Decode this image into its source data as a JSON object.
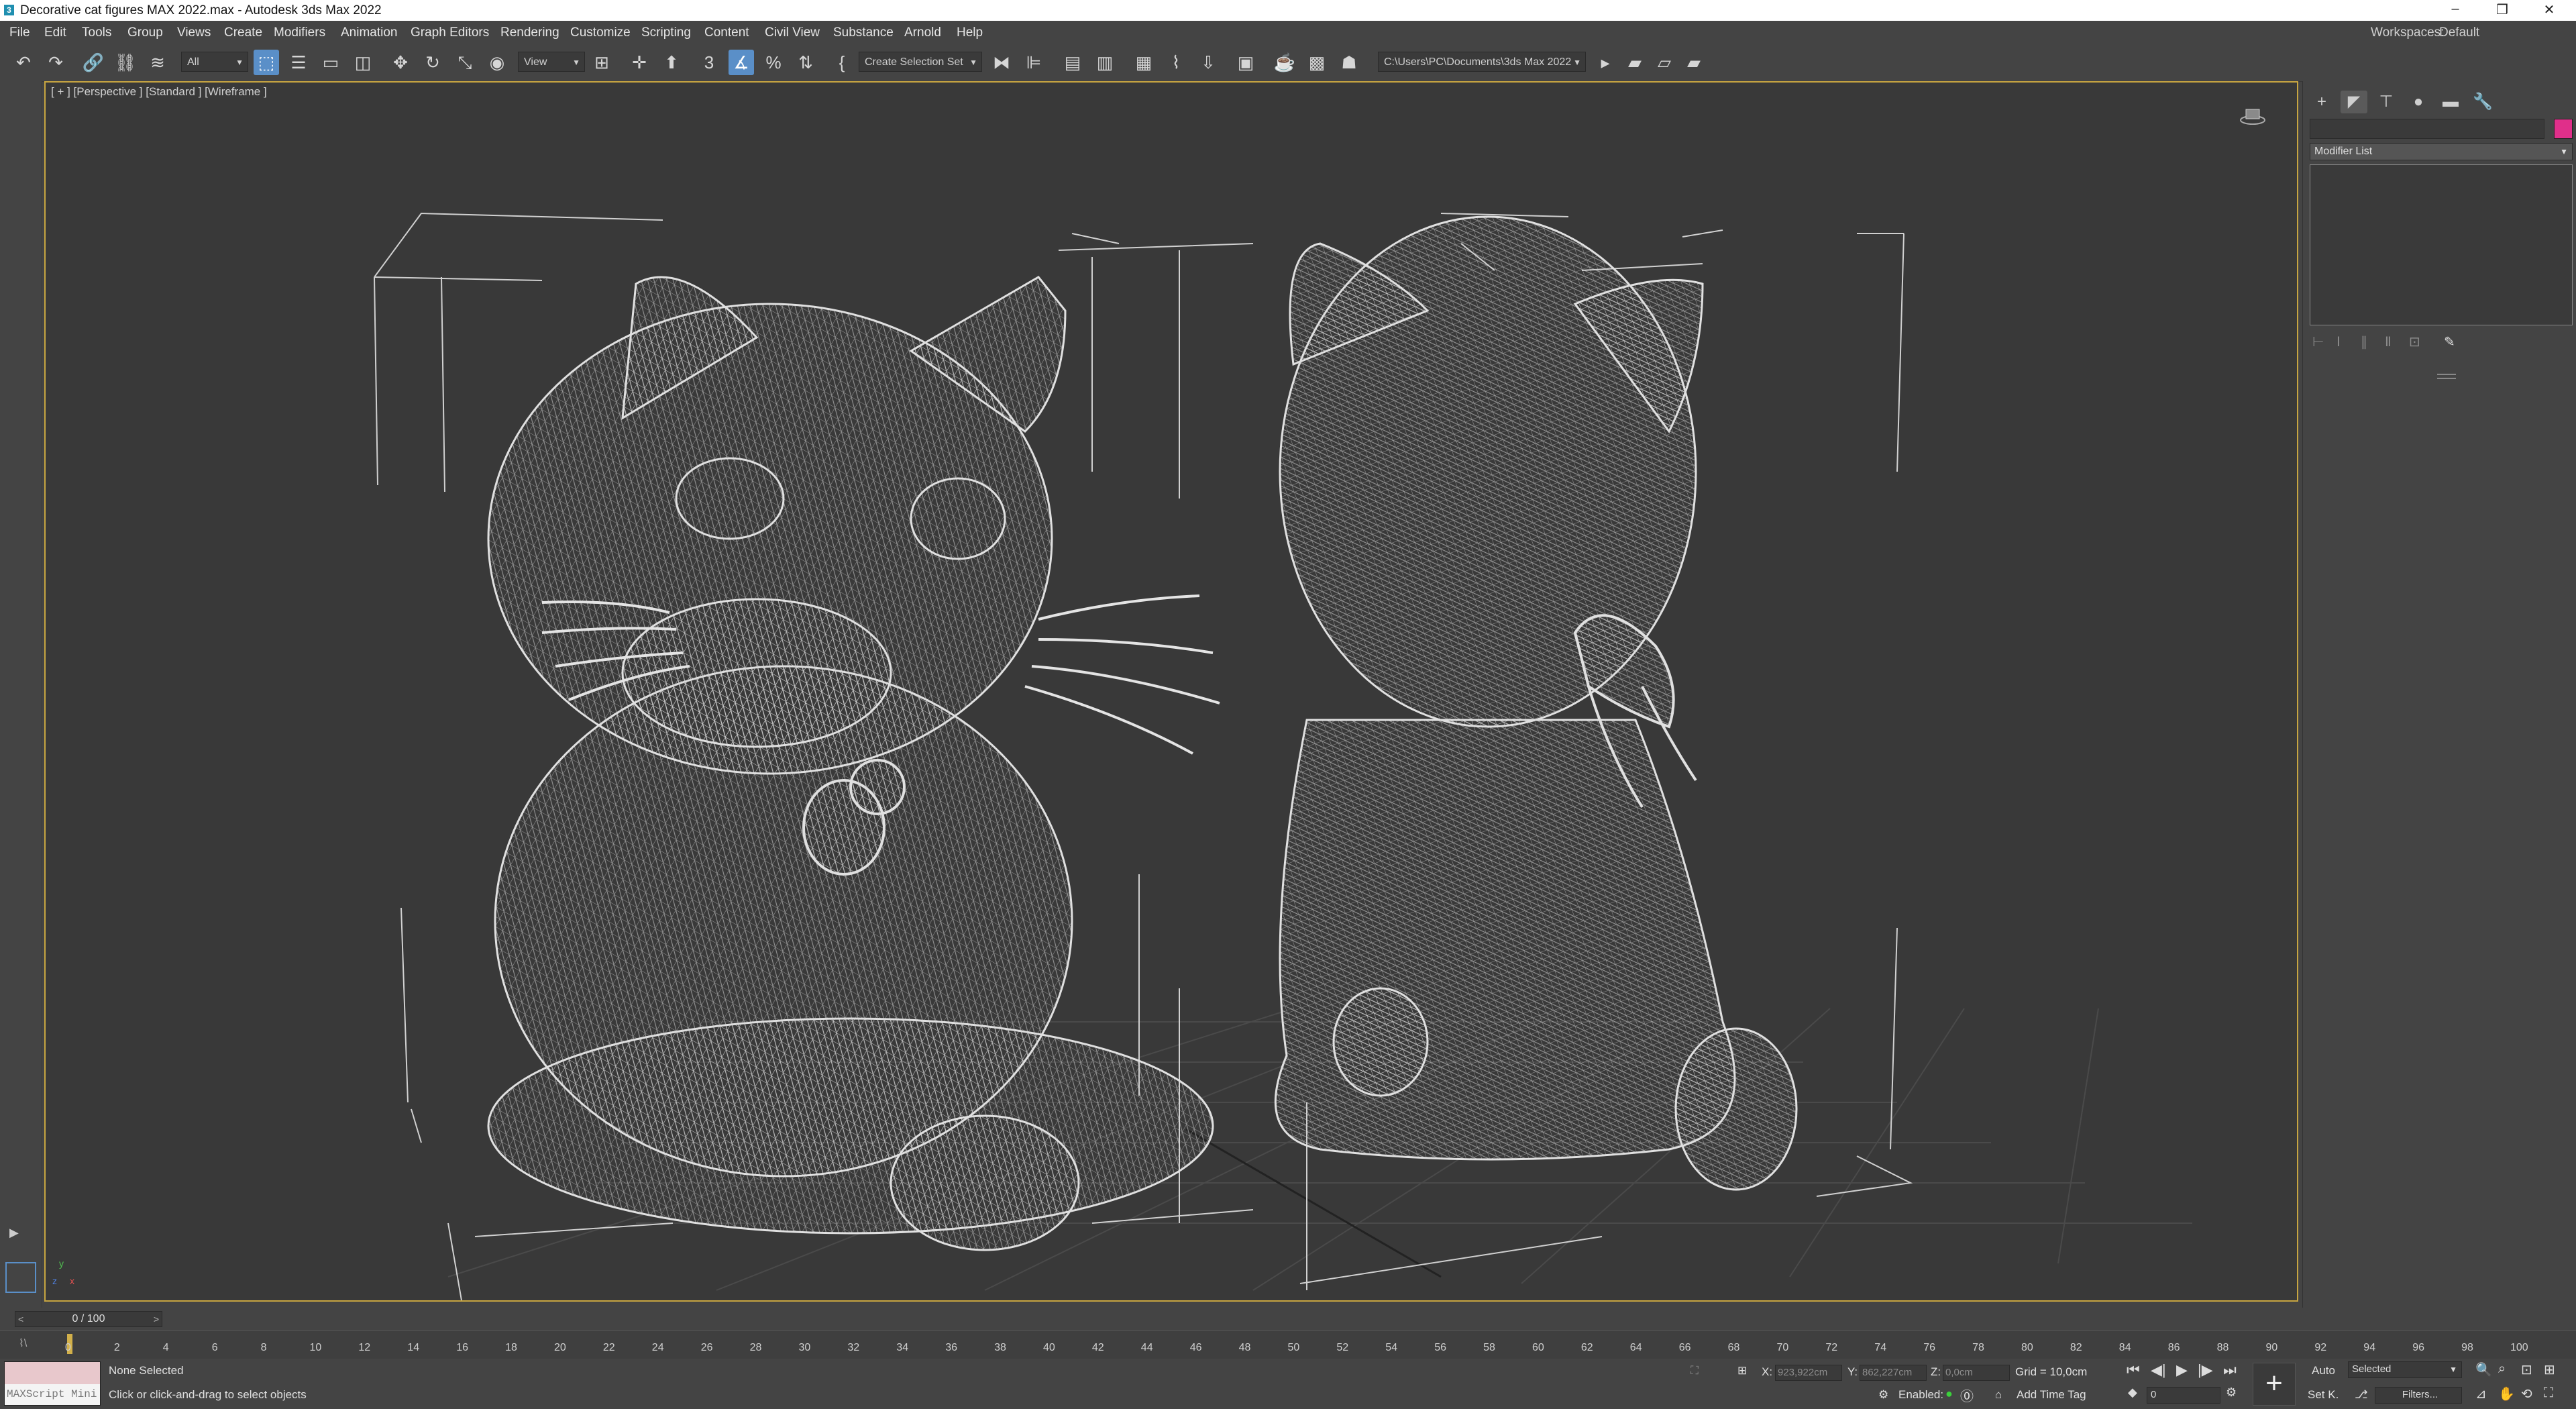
{
  "window": {
    "title": "Decorative cat figures MAX 2022.max - Autodesk 3ds Max 2022",
    "minimize": "–",
    "restore": "❐",
    "close": "✕"
  },
  "menu": {
    "items": [
      "File",
      "Edit",
      "Tools",
      "Group",
      "Views",
      "Create",
      "Modifiers",
      "Animation",
      "Graph Editors",
      "Rendering",
      "Customize",
      "Scripting",
      "Content",
      "Civil View",
      "Substance",
      "Arnold",
      "Help"
    ],
    "workspaces_label": "Workspaces:",
    "workspaces_value": "Default"
  },
  "toolbar": {
    "selection_filter": "All",
    "ref_coord": "View",
    "selection_set": "Create Selection Set",
    "project_path": "C:\\Users\\PC\\Documents\\3ds Max 2022",
    "snap_value": "3"
  },
  "viewport": {
    "label": "[ + ] [Perspective ] [Standard ] [Wireframe ]",
    "wire_color": "#cfcfcf",
    "grid_color": "#4a4a4a",
    "axis_x": "x",
    "axis_y": "y",
    "axis_z": "z"
  },
  "command_panel": {
    "modifier_list": "Modifier List",
    "object_color": "#e02f8a"
  },
  "time": {
    "slider": "0 / 100",
    "ticks": [
      "0",
      "2",
      "4",
      "6",
      "8",
      "10",
      "12",
      "14",
      "16",
      "18",
      "20",
      "22",
      "24",
      "26",
      "28",
      "30",
      "32",
      "34",
      "36",
      "38",
      "40",
      "42",
      "44",
      "46",
      "48",
      "50",
      "52",
      "54",
      "56",
      "58",
      "60",
      "62",
      "64",
      "66",
      "68",
      "70",
      "72",
      "74",
      "76",
      "78",
      "80",
      "82",
      "84",
      "86",
      "88",
      "90",
      "92",
      "94",
      "96",
      "98",
      "100"
    ]
  },
  "status": {
    "maxscript": "MAXScript Mini",
    "selection": "None Selected",
    "prompt": "Click or click-and-drag to select objects",
    "x_label": "X:",
    "x_value": "923,922cm",
    "y_label": "Y:",
    "y_value": "862,227cm",
    "z_label": "Z:",
    "z_value": "0,0cm",
    "grid": "Grid = 10,0cm",
    "enabled": "Enabled:",
    "add_time_tag": "Add Time Tag",
    "auto": "Auto",
    "set_key": "Set K.",
    "key_filter": "Selected",
    "filters": "Filters...",
    "frame": "0"
  }
}
